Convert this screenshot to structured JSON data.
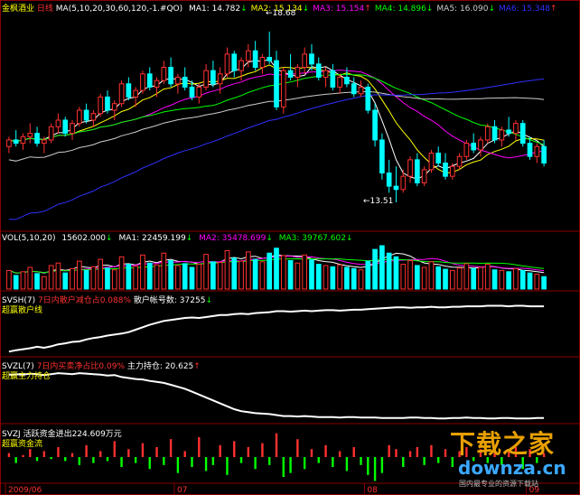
{
  "header": {
    "stock": "金枫酒业",
    "period": "日线",
    "ma_params": "MA(5,10,20,30,60,120,-1.#QO)",
    "ma_values": [
      {
        "label": "MA1:",
        "value": "14.782",
        "arrow": "↓",
        "color": "#ffffff"
      },
      {
        "label": "MA2:",
        "value": "15.134",
        "arrow": "↓",
        "color": "#ffff00"
      },
      {
        "label": "MA3:",
        "value": "15.154",
        "arrow": "↑",
        "color": "#ff00ff"
      },
      {
        "label": "MA4:",
        "value": "14.896",
        "arrow": "↓",
        "color": "#00ff00"
      },
      {
        "label": "MA5:",
        "value": "16.090",
        "arrow": "↓",
        "color": "#cccccc"
      },
      {
        "label": "MA6:",
        "value": "15.348",
        "arrow": "↑",
        "color": "#3030ff"
      }
    ]
  },
  "price_annotations": {
    "high": "18.68",
    "low": "13.51"
  },
  "volume_header": {
    "params": "VOL(5,10,20)",
    "vol": "15602.000",
    "vol_arrow": "↓",
    "ma1": "MA1: 22459.199",
    "ma1_arrow": "↓",
    "ma2": "MA2: 35478.699",
    "ma2_arrow": "↓",
    "ma3": "MA3: 39767.602",
    "ma3_arrow": "↓"
  },
  "svsh": {
    "label": "SVSH(7)",
    "text": "7日内散户减仓占0.088%",
    "count_label": "散户帐号数: 37255",
    "count_arrow": "↓",
    "name": "超赢散户线"
  },
  "svzl": {
    "label": "SVZL(7)",
    "text": "7日内买卖净占比0.09%",
    "hold_label": "主力持仓: 20.625",
    "hold_arrow": "↑",
    "name": "超赢主力持仓"
  },
  "svzj": {
    "label": "SVZJ",
    "text": "活跃资金进出224.609万元",
    "name": "超赢资金流"
  },
  "x_axis": [
    "2009/06",
    "07",
    "08",
    "09"
  ],
  "watermark": {
    "title": "下载之家",
    "url": "downza.cn",
    "slogan": "国内最专业的资源下载站"
  },
  "colors": {
    "up": "#ff3030",
    "down": "#00ffff",
    "bg": "#000000"
  },
  "chart_data": {
    "type": "candlestick",
    "x_labels": [
      "2009/06",
      "07",
      "08",
      "09"
    ],
    "price_ylim": [
      12.8,
      19.2
    ],
    "candles": [
      [
        15.2,
        15.5,
        15.0,
        15.4
      ],
      [
        15.4,
        15.7,
        15.2,
        15.3
      ],
      [
        15.3,
        15.6,
        15.1,
        15.5
      ],
      [
        15.5,
        15.9,
        15.3,
        15.6
      ],
      [
        15.6,
        15.8,
        15.2,
        15.3
      ],
      [
        15.3,
        15.5,
        15.0,
        15.4
      ],
      [
        15.4,
        15.9,
        15.3,
        15.8
      ],
      [
        15.8,
        16.2,
        15.6,
        16.0
      ],
      [
        16.0,
        16.1,
        15.5,
        15.6
      ],
      [
        15.6,
        16.0,
        15.4,
        15.9
      ],
      [
        15.9,
        16.4,
        15.8,
        16.3
      ],
      [
        16.3,
        16.5,
        15.9,
        16.0
      ],
      [
        16.0,
        16.3,
        15.8,
        16.2
      ],
      [
        16.2,
        16.8,
        16.1,
        16.7
      ],
      [
        16.7,
        16.9,
        16.2,
        16.3
      ],
      [
        16.3,
        16.6,
        16.0,
        16.5
      ],
      [
        16.5,
        17.2,
        16.4,
        17.1
      ],
      [
        17.1,
        17.3,
        16.6,
        16.7
      ],
      [
        16.7,
        17.0,
        16.4,
        16.9
      ],
      [
        16.9,
        17.5,
        16.8,
        17.4
      ],
      [
        17.4,
        17.6,
        16.9,
        17.0
      ],
      [
        17.0,
        17.3,
        16.7,
        17.2
      ],
      [
        17.2,
        17.8,
        17.1,
        17.6
      ],
      [
        17.6,
        17.9,
        17.0,
        17.1
      ],
      [
        17.1,
        17.4,
        16.8,
        17.3
      ],
      [
        17.3,
        17.6,
        16.9,
        17.0
      ],
      [
        17.0,
        17.2,
        16.6,
        16.7
      ],
      [
        16.7,
        17.1,
        16.5,
        17.0
      ],
      [
        17.0,
        17.7,
        16.9,
        17.5
      ],
      [
        17.5,
        17.8,
        17.0,
        17.1
      ],
      [
        17.1,
        17.6,
        16.8,
        17.4
      ],
      [
        17.4,
        18.2,
        17.3,
        18.0
      ],
      [
        18.0,
        18.1,
        17.3,
        17.5
      ],
      [
        17.5,
        17.9,
        17.2,
        17.8
      ],
      [
        17.8,
        18.3,
        17.6,
        18.1
      ],
      [
        18.1,
        18.4,
        17.5,
        17.6
      ],
      [
        17.6,
        18.0,
        17.4,
        17.9
      ],
      [
        17.9,
        18.68,
        17.7,
        17.8
      ],
      [
        17.8,
        18.1,
        16.3,
        16.4
      ],
      [
        16.4,
        17.6,
        16.2,
        17.5
      ],
      [
        17.5,
        18.0,
        17.2,
        17.3
      ],
      [
        17.3,
        17.7,
        17.0,
        17.6
      ],
      [
        17.6,
        18.2,
        17.4,
        18.0
      ],
      [
        18.0,
        18.3,
        17.5,
        17.7
      ],
      [
        17.7,
        17.9,
        17.2,
        17.3
      ],
      [
        17.3,
        17.6,
        17.0,
        17.5
      ],
      [
        17.5,
        17.7,
        16.9,
        17.0
      ],
      [
        17.0,
        17.4,
        16.8,
        17.3
      ],
      [
        17.3,
        17.6,
        17.0,
        17.1
      ],
      [
        17.1,
        17.3,
        16.7,
        16.8
      ],
      [
        16.8,
        17.2,
        16.7,
        17.0
      ],
      [
        17.0,
        17.1,
        16.2,
        16.3
      ],
      [
        16.3,
        16.5,
        15.2,
        15.4
      ],
      [
        15.4,
        15.6,
        14.2,
        14.4
      ],
      [
        14.4,
        14.8,
        13.8,
        14.0
      ],
      [
        14.0,
        14.6,
        13.51,
        13.9
      ],
      [
        13.9,
        14.5,
        13.8,
        14.3
      ],
      [
        14.3,
        14.9,
        14.1,
        14.8
      ],
      [
        14.8,
        15.0,
        14.0,
        14.1
      ],
      [
        14.1,
        14.6,
        14.0,
        14.5
      ],
      [
        14.5,
        15.1,
        14.4,
        15.0
      ],
      [
        15.0,
        15.2,
        14.6,
        14.7
      ],
      [
        14.7,
        15.0,
        14.2,
        14.3
      ],
      [
        14.3,
        14.7,
        14.2,
        14.6
      ],
      [
        14.6,
        15.0,
        14.5,
        14.9
      ],
      [
        14.9,
        15.4,
        14.8,
        15.3
      ],
      [
        15.3,
        15.6,
        15.0,
        15.1
      ],
      [
        15.1,
        15.5,
        14.9,
        15.4
      ],
      [
        15.4,
        15.9,
        15.3,
        15.8
      ],
      [
        15.8,
        16.0,
        15.3,
        15.4
      ],
      [
        15.4,
        15.8,
        15.2,
        15.7
      ],
      [
        15.7,
        16.1,
        15.5,
        15.6
      ],
      [
        15.6,
        16.0,
        15.4,
        15.9
      ],
      [
        15.9,
        16.0,
        15.2,
        15.3
      ],
      [
        15.3,
        15.5,
        14.8,
        14.9
      ],
      [
        14.9,
        15.3,
        14.7,
        15.2
      ],
      [
        15.2,
        15.4,
        14.6,
        14.7
      ]
    ],
    "volumes": [
      30,
      22,
      28,
      35,
      25,
      20,
      38,
      42,
      26,
      33,
      45,
      30,
      36,
      48,
      34,
      31,
      52,
      40,
      37,
      55,
      42,
      39,
      58,
      46,
      38,
      41,
      35,
      40,
      56,
      44,
      43,
      62,
      50,
      45,
      60,
      48,
      44,
      58,
      66,
      54,
      46,
      42,
      55,
      47,
      40,
      38,
      36,
      39,
      35,
      33,
      31,
      45,
      64,
      70,
      58,
      52,
      40,
      46,
      38,
      35,
      44,
      36,
      32,
      30,
      34,
      41,
      33,
      35,
      40,
      31,
      30,
      28,
      33,
      30,
      26,
      24,
      20
    ],
    "svsh_values": [
      0.05,
      0.08,
      0.1,
      0.12,
      0.15,
      0.13,
      0.16,
      0.2,
      0.22,
      0.25,
      0.26,
      0.3,
      0.33,
      0.35,
      0.38,
      0.4,
      0.42,
      0.45,
      0.5,
      0.55,
      0.6,
      0.64,
      0.68,
      0.7,
      0.72,
      0.74,
      0.75,
      0.74,
      0.76,
      0.78,
      0.8,
      0.8,
      0.82,
      0.83,
      0.82,
      0.84,
      0.85,
      0.86,
      0.88,
      0.88,
      0.87,
      0.88,
      0.89,
      0.88,
      0.89,
      0.9,
      0.9,
      0.89,
      0.9,
      0.91,
      0.91,
      0.92,
      0.93,
      0.94,
      0.95,
      0.96,
      0.96,
      0.95,
      0.96,
      0.96,
      0.97,
      0.96,
      0.96,
      0.97,
      0.97,
      0.98,
      0.98,
      0.98,
      0.99,
      0.99,
      0.99,
      0.98,
      0.99,
      0.99,
      0.98,
      0.98,
      0.98
    ],
    "svzl_values": [
      0.95,
      0.96,
      0.95,
      0.97,
      0.96,
      0.94,
      0.96,
      0.98,
      0.97,
      0.96,
      0.98,
      0.97,
      0.96,
      0.95,
      0.93,
      0.94,
      0.9,
      0.88,
      0.86,
      0.85,
      0.82,
      0.8,
      0.78,
      0.74,
      0.7,
      0.66,
      0.6,
      0.54,
      0.48,
      0.42,
      0.36,
      0.3,
      0.24,
      0.2,
      0.18,
      0.16,
      0.15,
      0.14,
      0.12,
      0.1,
      0.1,
      0.09,
      0.1,
      0.09,
      0.08,
      0.08,
      0.08,
      0.07,
      0.08,
      0.08,
      0.07,
      0.07,
      0.07,
      0.06,
      0.06,
      0.06,
      0.06,
      0.07,
      0.07,
      0.06,
      0.06,
      0.05,
      0.05,
      0.06,
      0.06,
      0.07,
      0.06,
      0.06,
      0.05,
      0.05,
      0.06,
      0.06,
      0.05,
      0.05,
      0.05,
      0.06,
      0.06
    ],
    "svzj_values": [
      2,
      -3,
      1,
      4,
      -2,
      3,
      -1,
      5,
      -2,
      2,
      -4,
      6,
      -3,
      3,
      -2,
      8,
      -5,
      4,
      -3,
      7,
      -6,
      5,
      -4,
      9,
      -8,
      3,
      -5,
      10,
      -7,
      -4,
      6,
      -9,
      8,
      -3,
      5,
      -6,
      7,
      -4,
      12,
      -10,
      -8,
      9,
      -6,
      4,
      -3,
      6,
      -5,
      3,
      -7,
      5,
      -4,
      -9,
      -12,
      -8,
      6,
      4,
      -5,
      3,
      5,
      -4,
      6,
      -3,
      4,
      -5,
      3,
      5,
      -2,
      4,
      -3,
      6,
      -4,
      3,
      5,
      -6,
      4,
      -3,
      2
    ],
    "ylabel": ""
  }
}
